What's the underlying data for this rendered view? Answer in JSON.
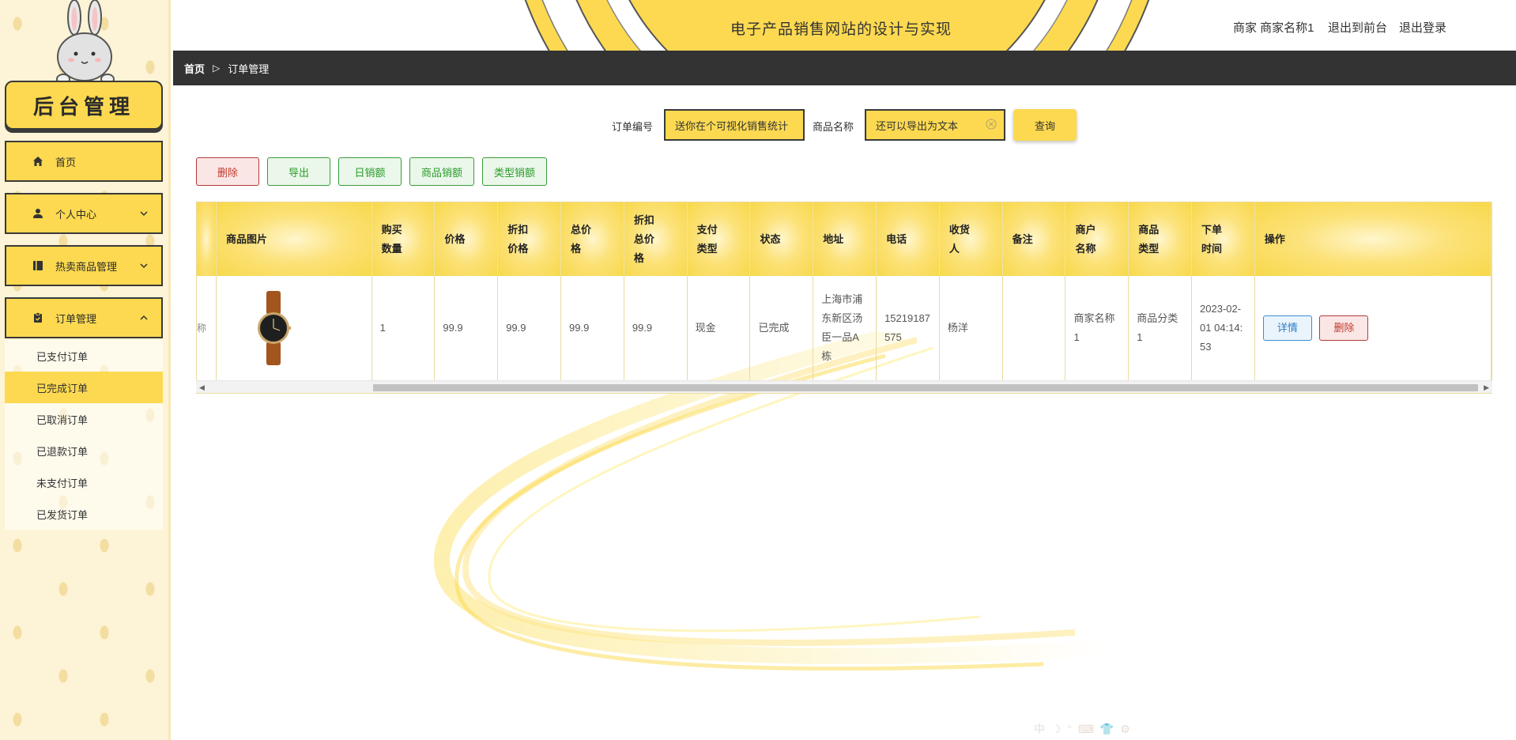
{
  "sidebar": {
    "brand_title": "后台管理",
    "menu": [
      {
        "label": "首页",
        "icon": "home-icon"
      },
      {
        "label": "个人中心",
        "icon": "user-icon"
      },
      {
        "label": "热卖商品管理",
        "icon": "book-icon"
      },
      {
        "label": "订单管理",
        "icon": "clipboard-icon"
      }
    ],
    "submenu": [
      {
        "label": "已支付订单",
        "active": false
      },
      {
        "label": "已完成订单",
        "active": true
      },
      {
        "label": "已取消订单",
        "active": false
      },
      {
        "label": "已退款订单",
        "active": false
      },
      {
        "label": "未支付订单",
        "active": false
      },
      {
        "label": "已发货订单",
        "active": false
      }
    ]
  },
  "header": {
    "title": "电子产品销售网站的设计与实现",
    "user": "商家 商家名称1",
    "back_link": "退出到前台",
    "logout_link": "退出登录"
  },
  "breadcrumb": {
    "home": "首页",
    "separator": "▷",
    "current": "订单管理"
  },
  "search": {
    "order_no_label": "订单编号",
    "order_no_value": "送你在个可视化销售统计",
    "product_name_label": "商品名称",
    "product_name_value": "还可以导出为文本",
    "query_button": "查询"
  },
  "actions": {
    "delete": "删除",
    "export": "导出",
    "daily_sales": "日销额",
    "product_sales": "商品销额",
    "type_sales": "类型销额"
  },
  "table": {
    "columns": [
      "商品图片",
      "购买\n数量",
      "价格",
      "折扣\n价格",
      "总价\n格",
      "折扣\n总价\n格",
      "支付\n类型",
      "状态",
      "地址",
      "电话",
      "收货\n人",
      "备注",
      "商户\n名称",
      "商品\n类型",
      "下单\n时间",
      "操作"
    ],
    "partial_left_cell": "称",
    "rows": [
      {
        "image": "watch-image",
        "qty": "1",
        "price": "99.9",
        "discount_price": "99.9",
        "total_price": "99.9",
        "discount_total": "99.9",
        "pay_type": "现金",
        "status": "已完成",
        "address": "上海市浦东新区汤臣一品A栋",
        "phone": "15219187575",
        "receiver": "杨洋",
        "remark": "",
        "merchant": "商家名称1",
        "product_type": "商品分类1",
        "order_time": "2023-02-01 04:14:53",
        "detail_button": "详情",
        "delete_button": "删除"
      }
    ]
  },
  "ime_toolbar": "中 ☽ ° ⌨ 👕 ⚙",
  "colors": {
    "accent_yellow": "#fcd950",
    "dark_bar": "#333333",
    "danger_red": "#c0392b",
    "success_green": "#2a9b2a",
    "info_blue": "#2a7cc4"
  }
}
